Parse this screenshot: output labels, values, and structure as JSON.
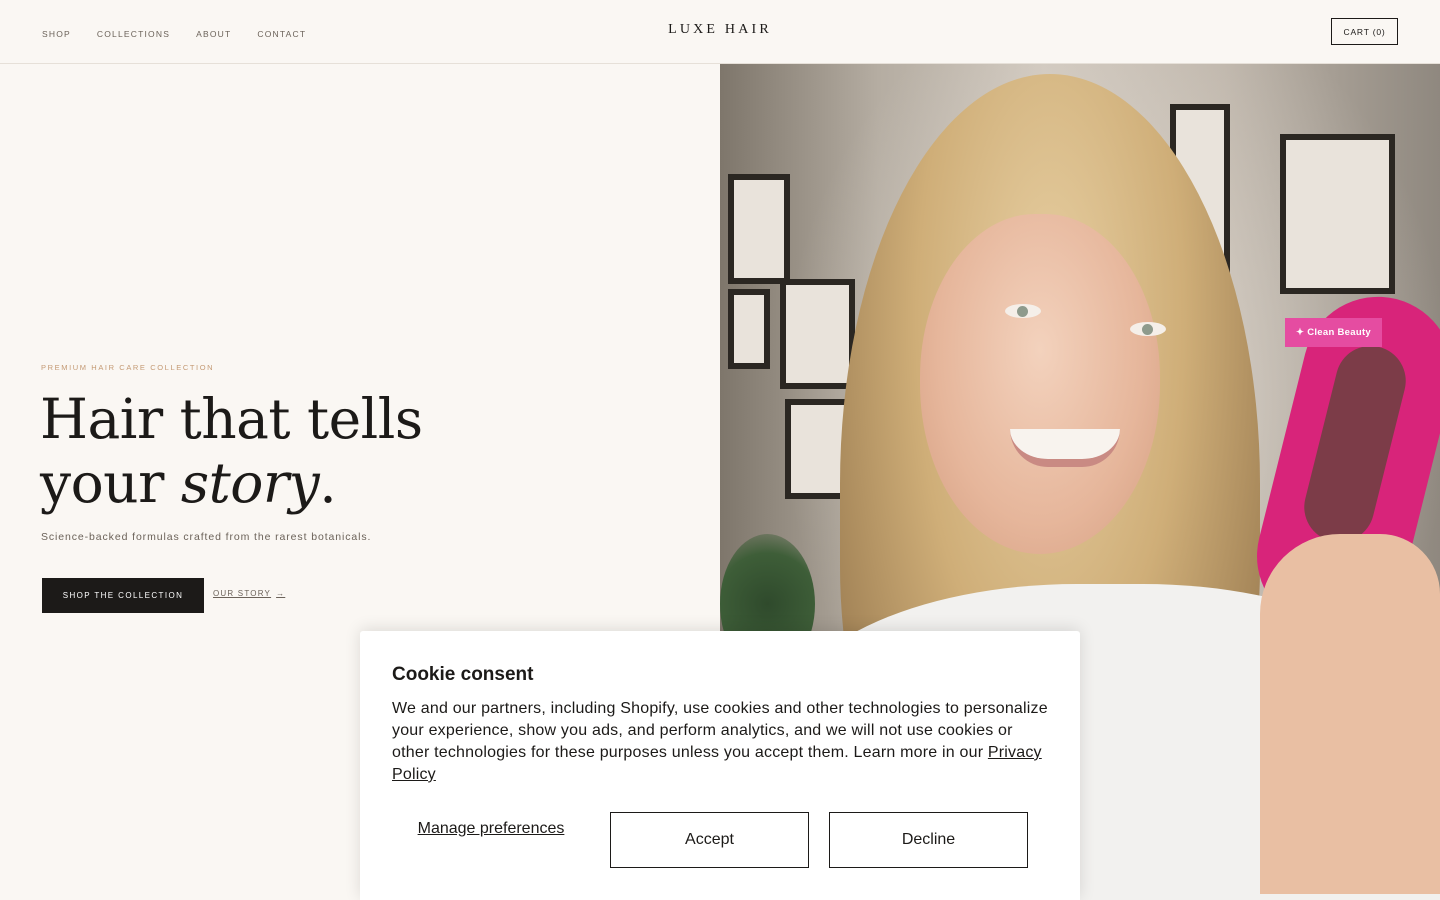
{
  "header": {
    "nav": [
      "SHOP",
      "COLLECTIONS",
      "ABOUT",
      "CONTACT"
    ],
    "logo": "LUXE HAIR",
    "cart_label": "CART (0)"
  },
  "hero": {
    "eyebrow": "PREMIUM HAIR CARE COLLECTION",
    "headline_line1": "Hair that tells",
    "headline_line2_plain": "your ",
    "headline_line2_italic": "story",
    "headline_period": ".",
    "subtitle": "Science-backed formulas crafted from the rarest botanicals.",
    "cta_primary": "SHOP THE COLLECTION",
    "cta_secondary": "OUR STORY",
    "cta_secondary_arrow": "→",
    "badge": "✦ Clean Beauty"
  },
  "cookie": {
    "title": "Cookie consent",
    "body": "We and our partners, including Shopify, use cookies and other technologies to personalize your experience, show you ads, and perform analytics, and we will not use cookies or other technologies for these purposes unless you accept them. Learn more in our ",
    "privacy_link": "Privacy Policy",
    "manage": "Manage preferences",
    "accept": "Accept",
    "decline": "Decline"
  },
  "colors": {
    "background": "#faf7f3",
    "text": "#1c1a18",
    "accent_tan": "#c49a74",
    "badge_pink": "#e54ca1"
  }
}
